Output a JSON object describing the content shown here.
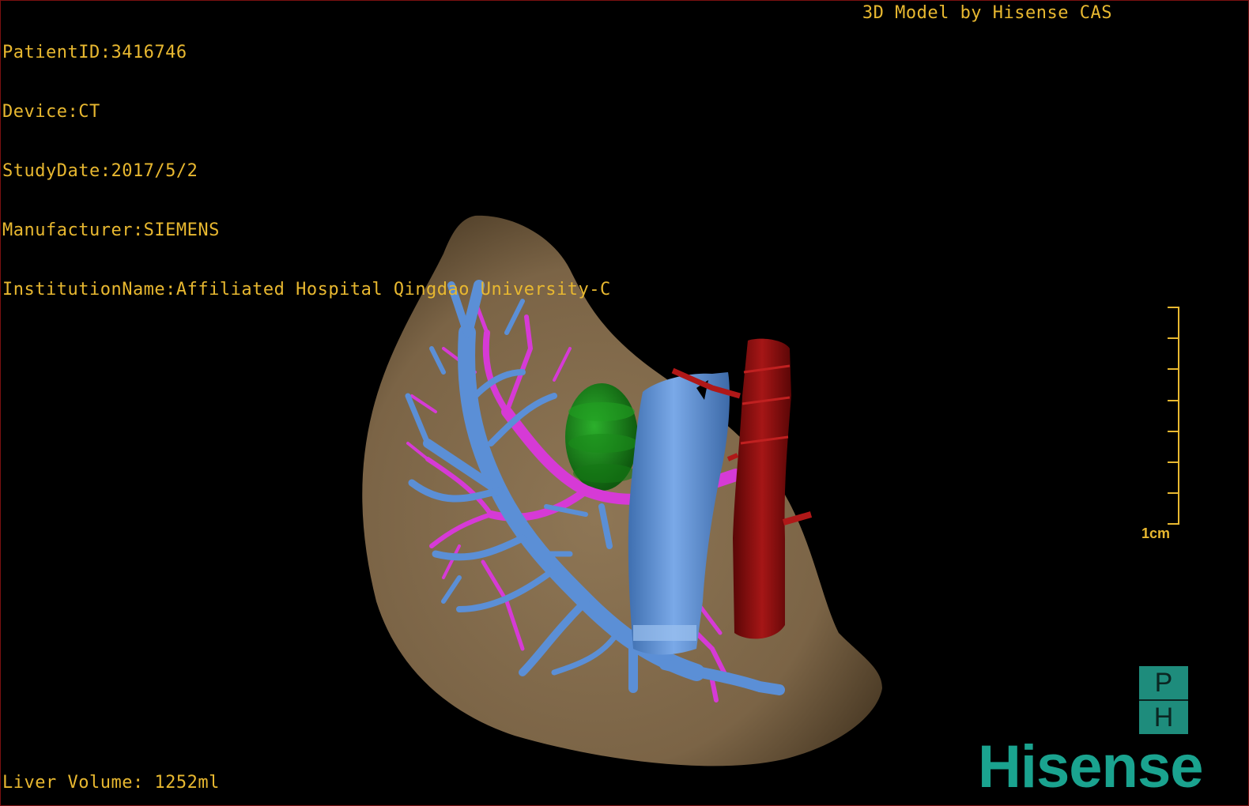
{
  "overlay": {
    "patient_id": "PatientID:3416746",
    "device": "Device:CT",
    "study_date": "StudyDate:2017/5/2",
    "manufacturer": "Manufacturer:SIEMENS",
    "institution": "InstitutionName:Affiliated Hospital Qingdao University-C",
    "credit": "3D Model by Hisense CAS",
    "liver_volume": "Liver Volume: 1252ml"
  },
  "scale": {
    "label": "1cm"
  },
  "branding": {
    "ph_top": "P",
    "ph_bottom": "H",
    "logo_text": "Hisense"
  },
  "colors": {
    "overlay_text": "#e8b830",
    "liver": "#8b7352",
    "portal_vein": "#5b8fd6",
    "hepatic_artery": "#d63ad6",
    "ivc": "#6fa0e0",
    "aorta": "#8f1010",
    "gallbladder": "#1c8c1c",
    "brand": "#1aa38f"
  }
}
